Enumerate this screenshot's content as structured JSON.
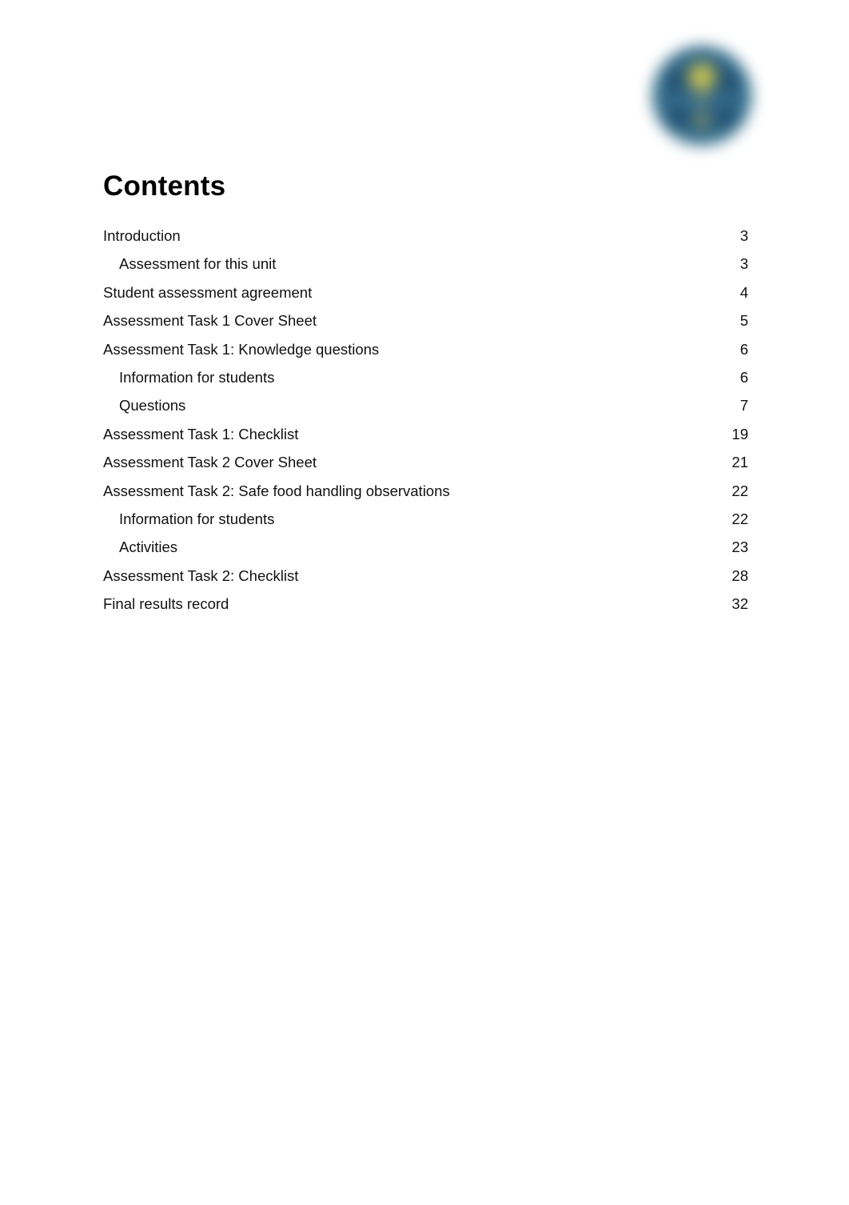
{
  "document": {
    "heading": "Contents",
    "background_color": "#ffffff",
    "text_color": "#111111"
  },
  "logo": {
    "name": "organisation-logo",
    "shape": "circle",
    "style": "blurred",
    "colors": {
      "circle_base": "#2f6186",
      "circle_dark": "#1c4a6b",
      "accent_yellow": "#d8cc4a",
      "accent_yellow_soft": "#b9b45a",
      "edge": "#35708f"
    }
  },
  "toc": {
    "entries": [
      {
        "label": "Introduction",
        "page": "3",
        "level": 1
      },
      {
        "label": "Assessment for this unit",
        "page": "3",
        "level": 2
      },
      {
        "label": "Student assessment agreement",
        "page": "4",
        "level": 1
      },
      {
        "label": "Assessment Task 1 Cover Sheet",
        "page": "5",
        "level": 1
      },
      {
        "label": "Assessment Task 1: Knowledge questions",
        "page": "6",
        "level": 1
      },
      {
        "label": "Information for students",
        "page": "6",
        "level": 2
      },
      {
        "label": "Questions",
        "page": "7",
        "level": 2
      },
      {
        "label": "Assessment Task 1: Checklist",
        "page": "19",
        "level": 1
      },
      {
        "label": "Assessment Task 2 Cover Sheet",
        "page": "21",
        "level": 1
      },
      {
        "label": "Assessment Task 2: Safe food handling observations",
        "page": "22",
        "level": 1
      },
      {
        "label": "Information for students",
        "page": "22",
        "level": 2
      },
      {
        "label": "Activities",
        "page": "23",
        "level": 2
      },
      {
        "label": "Assessment Task 2: Checklist",
        "page": "28",
        "level": 1
      },
      {
        "label": "Final results record",
        "page": "32",
        "level": 1
      }
    ]
  }
}
